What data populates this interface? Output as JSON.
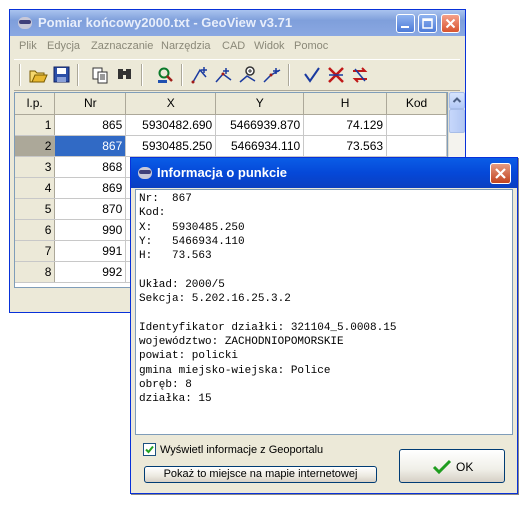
{
  "main_window": {
    "title": "Pomiar końcowy2000.txt - GeoView v3.71",
    "menu": [
      "Plik",
      "Edycja",
      "Zaznaczanie",
      "Narzędzia",
      "CAD",
      "Widok",
      "Pomoc"
    ],
    "toolbar_icons": [
      "open-icon",
      "save-icon",
      "copy-icon",
      "find-icon",
      "locate-icon",
      "point-add-icon",
      "point-move-icon",
      "zoom-point-icon",
      "point-edit-icon",
      "check-icon",
      "delete-icon",
      "swap-icon"
    ]
  },
  "grid": {
    "columns": [
      "l.p.",
      "Nr",
      "X",
      "Y",
      "H",
      "Kod"
    ],
    "rows": [
      {
        "lp": "1",
        "nr": "865",
        "x": "5930482.690",
        "y": "5466939.870",
        "h": "74.129",
        "kod": ""
      },
      {
        "lp": "2",
        "nr": "867",
        "x": "5930485.250",
        "y": "5466934.110",
        "h": "73.563",
        "kod": ""
      },
      {
        "lp": "3",
        "nr": "868",
        "x": "",
        "y": "",
        "h": "",
        "kod": ""
      },
      {
        "lp": "4",
        "nr": "869",
        "x": "",
        "y": "",
        "h": "",
        "kod": ""
      },
      {
        "lp": "5",
        "nr": "870",
        "x": "",
        "y": "",
        "h": "",
        "kod": ""
      },
      {
        "lp": "6",
        "nr": "990",
        "x": "",
        "y": "",
        "h": "",
        "kod": ""
      },
      {
        "lp": "7",
        "nr": "991",
        "x": "",
        "y": "",
        "h": "",
        "kod": ""
      },
      {
        "lp": "8",
        "nr": "992",
        "x": "",
        "y": "",
        "h": "",
        "kod": ""
      }
    ],
    "selected_row": 1
  },
  "dialog": {
    "title": "Informacja o punkcie",
    "lines": [
      "Nr:  867",
      "Kod:",
      "X:   5930485.250",
      "Y:   5466934.110",
      "H:   73.563",
      "",
      "Układ: 2000/5",
      "Sekcja: 5.202.16.25.3.2",
      "",
      "Identyfikator działki: 321104_5.0008.15",
      "województwo: ZACHODNIOPOMORSKIE",
      "powiat: policki",
      "gmina miejsko-wiejska: Police",
      "obręb: 8",
      "działka: 15"
    ],
    "checkbox_label": "Wyświetl informacje z Geoportalu",
    "checkbox_checked": true,
    "map_button_label": "Pokaż to miejsce na mapie internetowej",
    "ok_label": "OK"
  }
}
